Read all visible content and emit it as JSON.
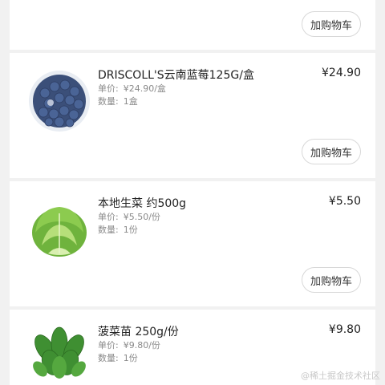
{
  "top_card": {
    "cart_button": "加购物车"
  },
  "products": [
    {
      "name": "DRISCOLL'S云南蓝莓125G/盒",
      "price": "¥24.90",
      "unit_label": "单价:",
      "unit_price": "¥24.90/盒",
      "qty_label": "数量:",
      "qty": "1盒",
      "cart_button": "加购物车",
      "image_icon": "blueberry-image"
    },
    {
      "name": " 本地生菜 约500g",
      "price": "¥5.50",
      "unit_label": "单价:",
      "unit_price": "¥5.50/份",
      "qty_label": "数量:",
      "qty": "1份",
      "cart_button": "加购物车",
      "image_icon": "lettuce-image"
    },
    {
      "name": "菠菜苗 250g/份",
      "price": "¥9.80",
      "unit_label": "单价:",
      "unit_price": "¥9.80/份",
      "qty_label": "数量:",
      "qty": "1份",
      "image_icon": "spinach-image"
    }
  ],
  "watermark": "@稀土掘金技术社区"
}
